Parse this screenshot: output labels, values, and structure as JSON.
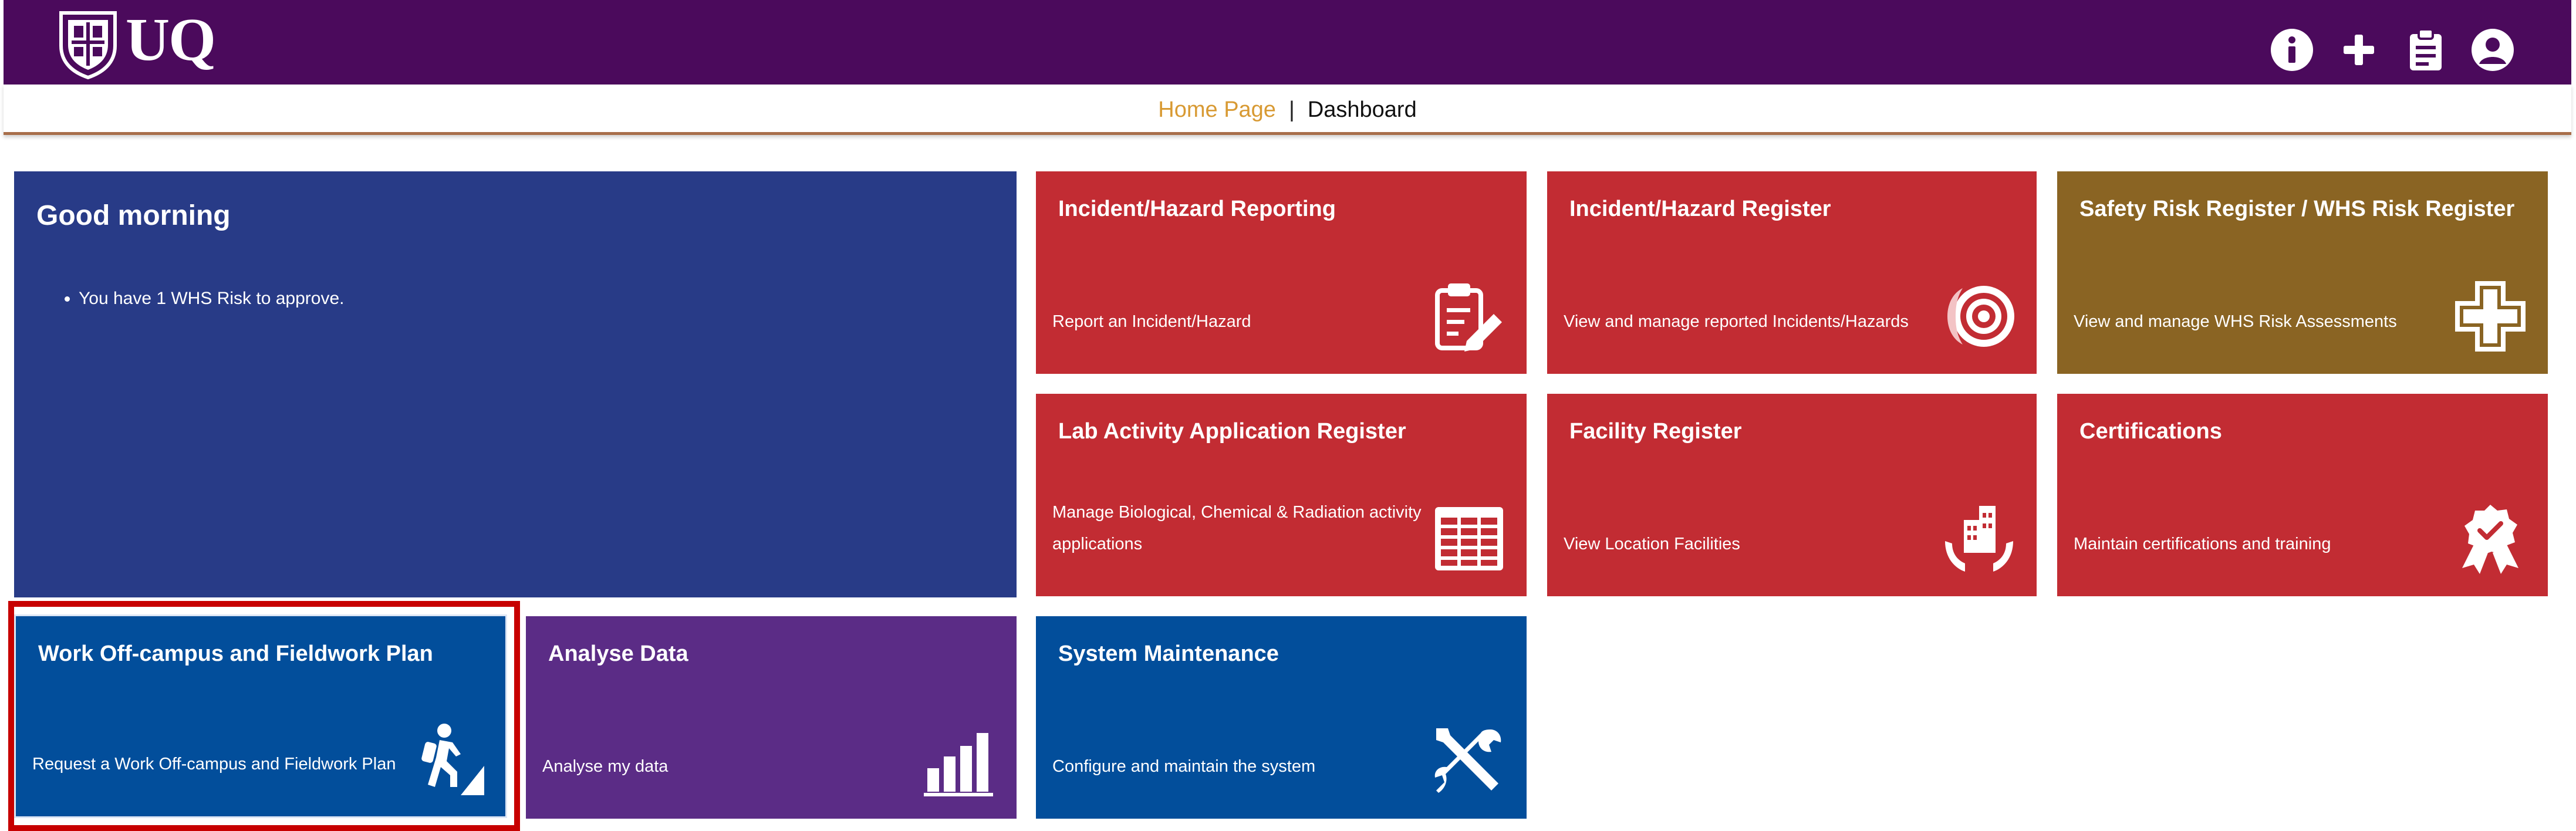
{
  "header": {
    "logo_text": "UQ",
    "icons": [
      "info-icon",
      "plus-icon",
      "clipboard-icon",
      "account-icon"
    ]
  },
  "breadcrumb": {
    "home": "Home Page",
    "separator": "|",
    "current": "Dashboard"
  },
  "greeting": {
    "title": "Good morning",
    "items": [
      "You have 1 WHS Risk to approve."
    ]
  },
  "tiles": {
    "incident_reporting": {
      "title": "Incident/Hazard Reporting",
      "desc": "Report an Incident/Hazard",
      "icon": "clipboard-edit-icon"
    },
    "incident_register": {
      "title": "Incident/Hazard Register",
      "desc": "View and manage reported Incidents/Hazards",
      "icon": "target-icon"
    },
    "safety_risk": {
      "title": "Safety Risk Register / WHS Risk Register",
      "desc": "View and manage WHS Risk Assessments",
      "icon": "medical-cross-icon"
    },
    "lab_activity": {
      "title": "Lab Activity Application Register",
      "desc": "Manage Biological, Chemical & Radiation activity applications",
      "icon": "table-icon"
    },
    "facility": {
      "title": "Facility Register",
      "desc": "View Location Facilities",
      "icon": "building-hands-icon"
    },
    "certifications": {
      "title": "Certifications",
      "desc": "Maintain certifications and training",
      "icon": "award-ribbon-icon"
    },
    "work_offcampus": {
      "title": "Work Off-campus and Fieldwork Plan",
      "desc": "Request a Work Off-campus and Fieldwork Plan",
      "icon": "hiker-icon"
    },
    "analyse": {
      "title": "Analyse Data",
      "desc": "Analyse my data",
      "icon": "bar-chart-icon"
    },
    "system": {
      "title": "System Maintenance",
      "desc": "Configure and maintain the system",
      "icon": "tools-icon"
    }
  },
  "colors": {
    "topbar": "#4b0a5c",
    "greeting": "#283b87",
    "red_tile": "#c22c33",
    "olive_tile": "#8a6423",
    "blue_tile": "#024e9b",
    "purple_tile": "#5b2c86",
    "highlight": "#c70000",
    "breadcrumb_link": "#d89a33"
  }
}
